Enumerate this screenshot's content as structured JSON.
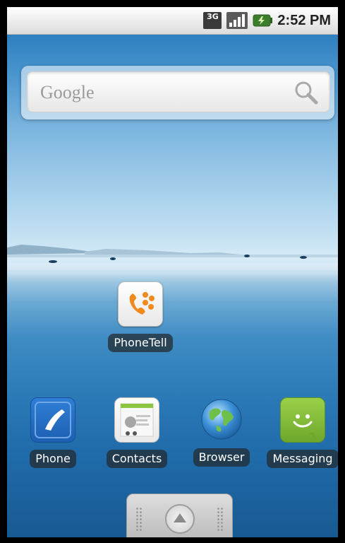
{
  "status_bar": {
    "network_label": "3G",
    "time": "2:52 PM",
    "icons": [
      "3g-data-icon",
      "signal-icon",
      "battery-charging-icon"
    ]
  },
  "search_widget": {
    "placeholder": "Google",
    "icon": "search-icon"
  },
  "workspace_apps": [
    {
      "label": "PhoneTell",
      "icon": "phonetell-app-icon"
    }
  ],
  "dock_apps": [
    {
      "label": "Phone",
      "icon": "phone-app-icon"
    },
    {
      "label": "Contacts",
      "icon": "contacts-app-icon"
    },
    {
      "label": "Browser",
      "icon": "browser-globe-icon"
    },
    {
      "label": "Messaging",
      "icon": "messaging-app-icon"
    }
  ],
  "drawer": {
    "icon": "app-drawer-icon"
  },
  "colors": {
    "accent_orange": "#f08a1c",
    "phone_blue": "#1f66b8",
    "messaging_green": "#7fb63a"
  }
}
